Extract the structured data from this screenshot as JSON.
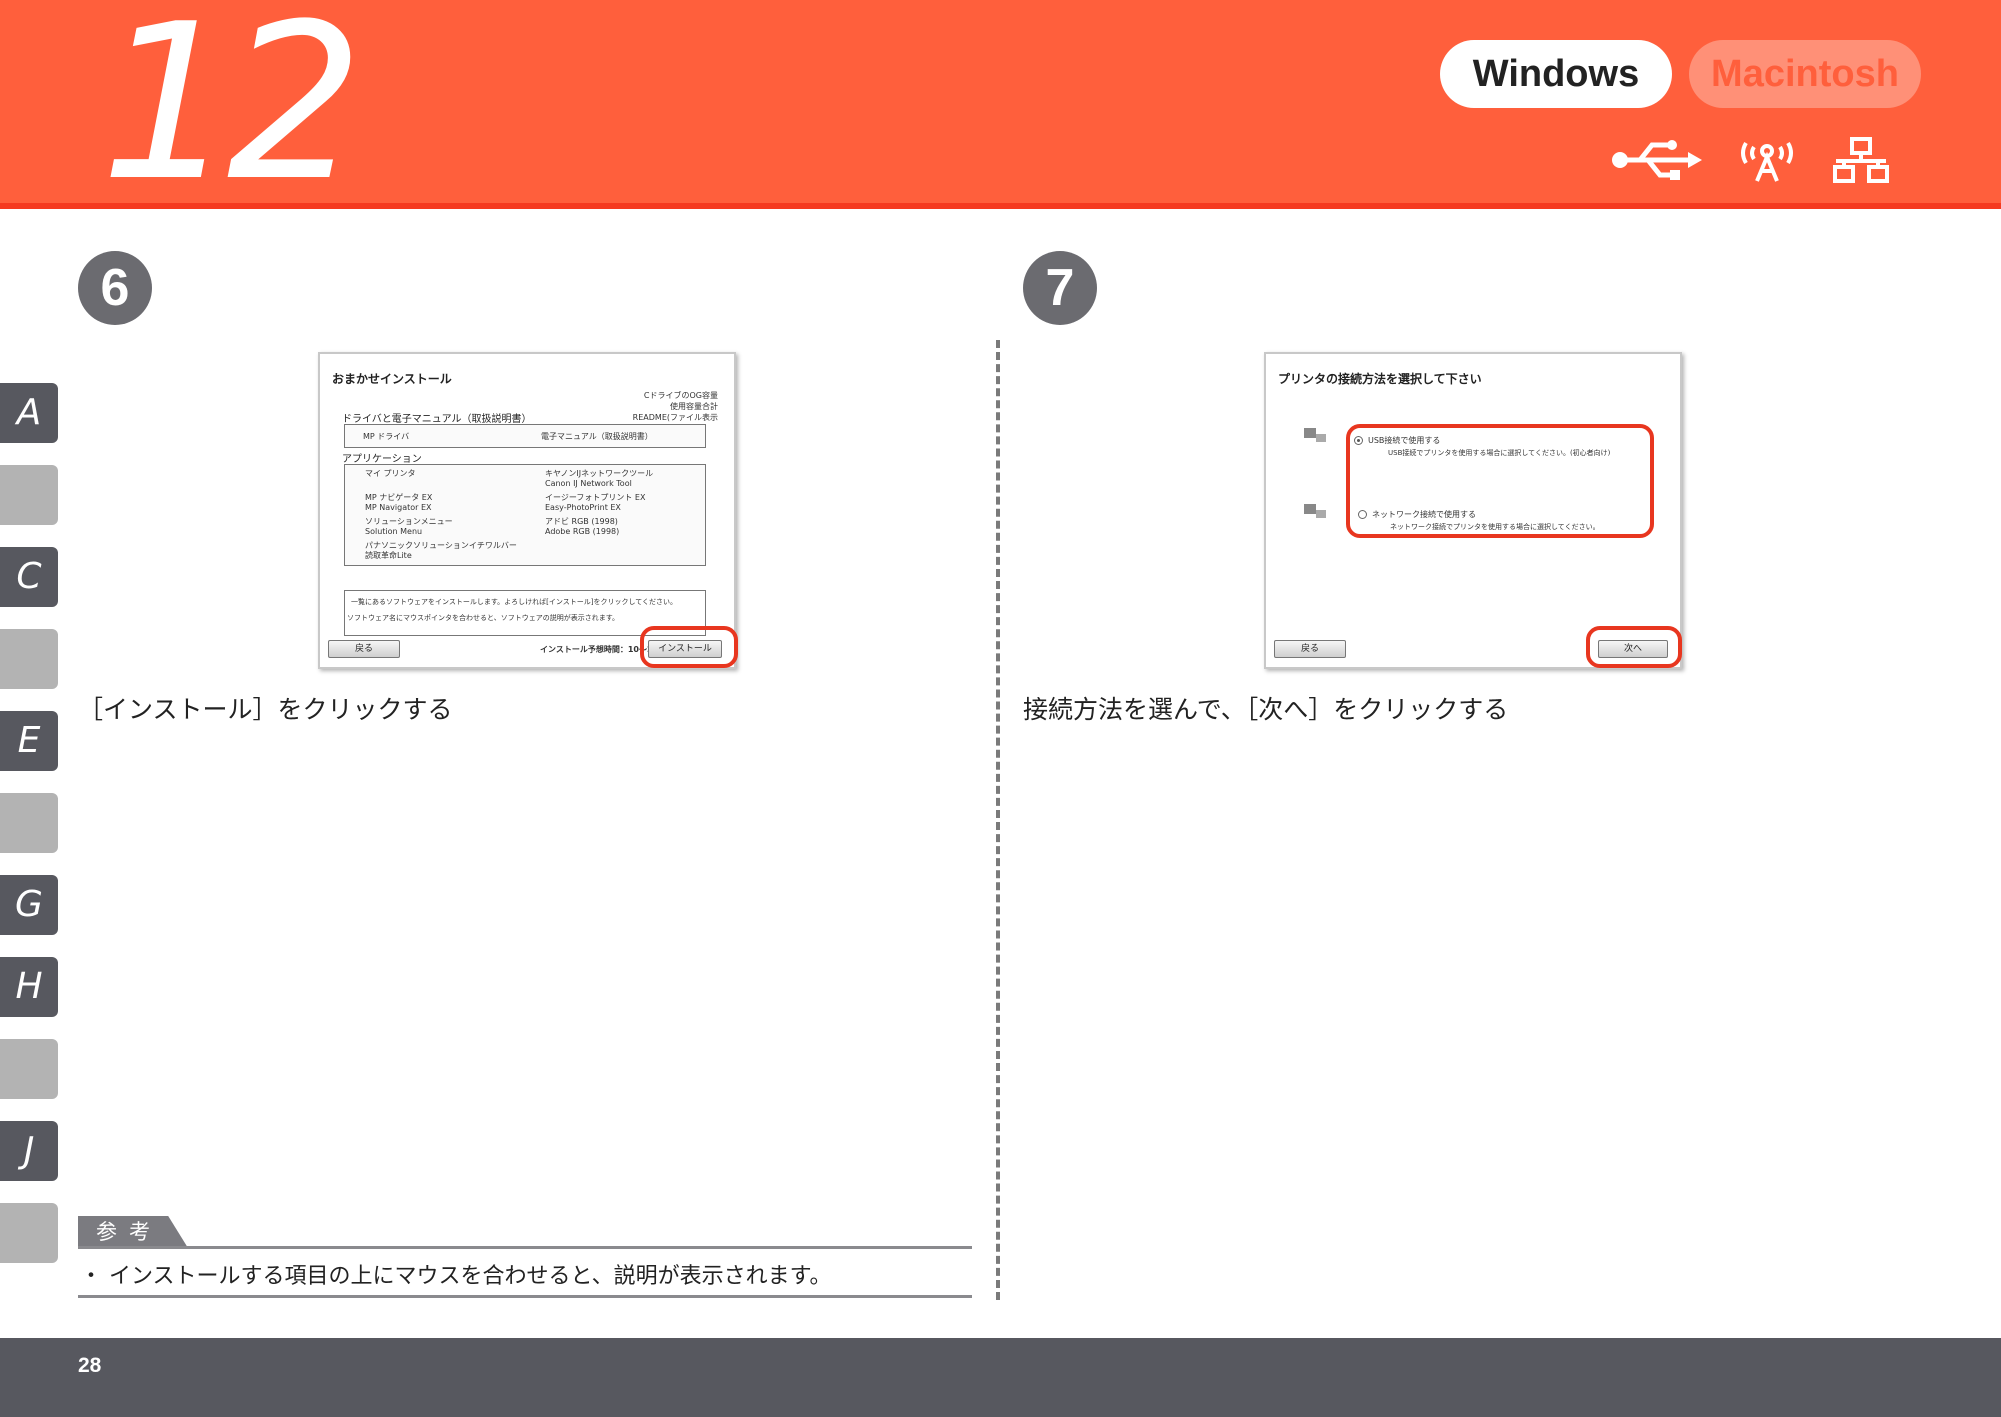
{
  "header": {
    "step_number": "12",
    "os_windows": "Windows",
    "os_mac": "Macintosh",
    "connection_icons": [
      "usb-icon",
      "wireless-icon",
      "network-icon"
    ]
  },
  "side_tabs": [
    "A",
    "",
    "C",
    "",
    "E",
    "",
    "G",
    "H",
    "",
    "J",
    ""
  ],
  "step6": {
    "number": "6",
    "dialog": {
      "title": "おまかせインストール",
      "disk_free": "CドライブのOG容量",
      "disk_used": "使用容量合計",
      "readme": "README(ファイル表示",
      "section_drivers": "ドライバと電子マニュアル（取扱説明書）",
      "driver_item": "MP ドライバ",
      "manual_item": "電子マニュアル（取扱説明書）",
      "section_apps": "アプリケーション",
      "apps_left": [
        {
          "line1": "マイ プリンタ",
          "line2": ""
        },
        {
          "line1": "MP ナビゲータ EX",
          "line2": "MP Navigator EX"
        },
        {
          "line1": "ソリューションメニュー",
          "line2": "Solution Menu"
        },
        {
          "line1": "パナソニックソリューションイチワルバー",
          "line2": "読取革命Lite"
        }
      ],
      "apps_right": [
        {
          "line1": "キヤノンIJネットワークツール",
          "line2": "Canon IJ Network Tool"
        },
        {
          "line1": "イージーフォトプリント EX",
          "line2": "Easy-PhotoPrint EX"
        },
        {
          "line1": "アドビ RGB (1998)",
          "line2": "Adobe RGB (1998)"
        }
      ],
      "desc_line1": "一覧にあるソフトウェアをインストールします。よろしければ[インストール]をクリックしてください。",
      "desc_line2": "ソフトウェア名にマウスポインタを合わせると、ソフトウェアの説明が表示されます。",
      "back_button": "戻る",
      "time_estimate": "インストール予想時間：10～20分",
      "install_button": "インストール"
    },
    "caption": "［インストール］をクリックする"
  },
  "step7": {
    "number": "7",
    "dialog": {
      "title": "プリンタの接続方法を選択して下さい",
      "option_usb": "USB接続で使用する",
      "option_usb_desc": "USB接続でプリンタを使用する場合に選択してください。(初心者向け)",
      "option_network": "ネットワーク接続で使用する",
      "option_network_desc": "ネットワーク接続でプリンタを使用する場合に選択してください。",
      "back_button": "戻る",
      "next_button": "次へ"
    },
    "caption": "接続方法を選んで、［次へ］をクリックする"
  },
  "note": {
    "label": "参考",
    "text": "・ インストールする項目の上にマウスを合わせると、説明が表示されます。"
  },
  "footer": {
    "page_number": "28"
  },
  "colors": {
    "header_orange": "#ff5f3c",
    "highlight_red": "#e8361f",
    "footer_gray": "#57585f"
  }
}
